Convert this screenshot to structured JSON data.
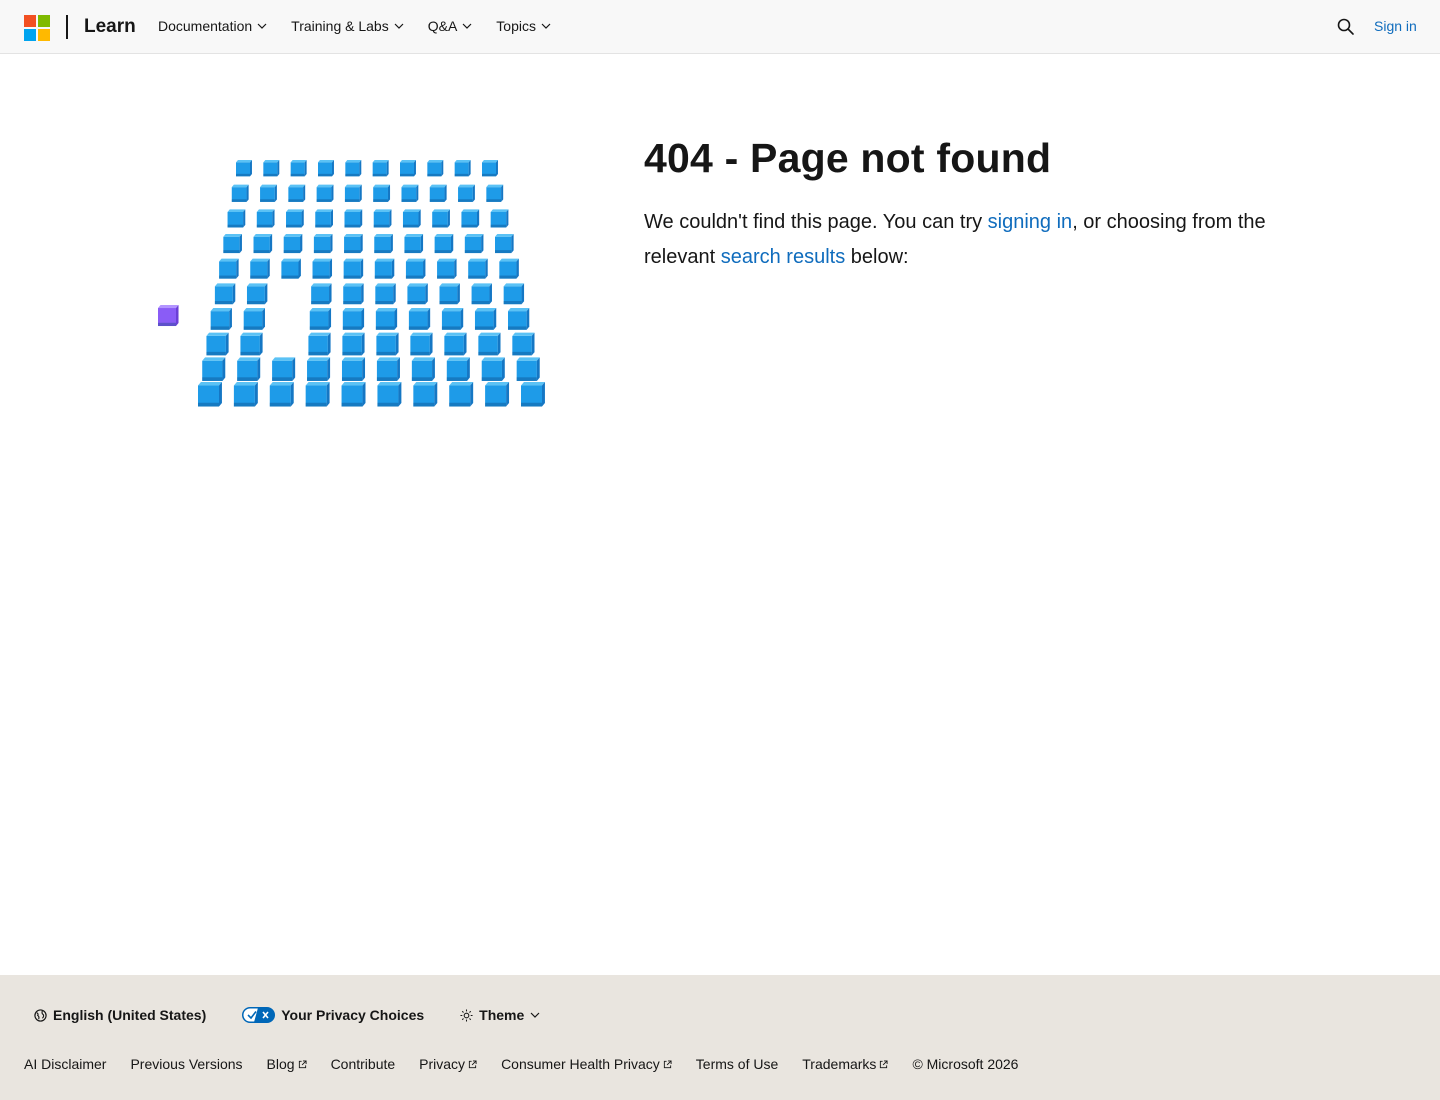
{
  "header": {
    "brand": "Learn",
    "logo_colors": [
      "#f25022",
      "#7fba00",
      "#00a4ef",
      "#ffb900"
    ],
    "nav": [
      {
        "label": "Documentation"
      },
      {
        "label": "Training & Labs"
      },
      {
        "label": "Q&A"
      },
      {
        "label": "Topics"
      }
    ],
    "sign_in": "Sign in"
  },
  "main": {
    "title": "404 - Page not found",
    "message_part1": "We couldn't find this page. You can try ",
    "link_sign_in": "signing in",
    "message_part2": ", or choosing from the relevant ",
    "link_search": "search results",
    "message_part3": " below:"
  },
  "footer": {
    "language": "English (United States)",
    "privacy_choices": "Your Privacy Choices",
    "theme": "Theme",
    "links": [
      {
        "label": "AI Disclaimer",
        "external": false
      },
      {
        "label": "Previous Versions",
        "external": false
      },
      {
        "label": "Blog",
        "external": true
      },
      {
        "label": "Contribute",
        "external": false
      },
      {
        "label": "Privacy",
        "external": true
      },
      {
        "label": "Consumer Health Privacy",
        "external": true
      },
      {
        "label": "Terms of Use",
        "external": false
      },
      {
        "label": "Trademarks",
        "external": true
      }
    ],
    "copyright": "© Microsoft 2026"
  },
  "colors": {
    "accent": "#0f6cbd",
    "cube_blue": "#1e9be8",
    "cube_purple": "#8a5cf6",
    "footer_bg": "#e9e5df"
  }
}
